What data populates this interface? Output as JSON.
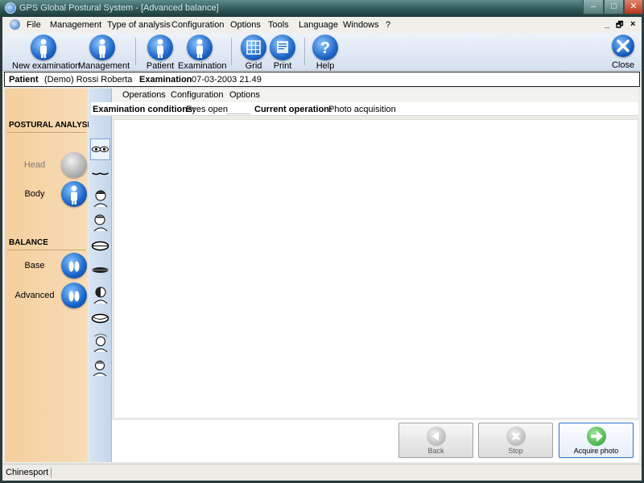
{
  "window": {
    "title": "GPS Global Postural System - [Advanced balance]",
    "minimize": "–",
    "maximize": "□",
    "close": "✕"
  },
  "menu": {
    "items": [
      "File",
      "Management",
      "Type of analysis",
      "Configuration",
      "Options",
      "Tools",
      "Language",
      "Windows",
      "?"
    ],
    "mdi_minimize": "_",
    "mdi_restore": "🗗",
    "mdi_close": "×"
  },
  "toolbar": {
    "new_examination": "New examination",
    "management": "Management",
    "patient": "Patient",
    "examination": "Examination",
    "grid": "Grid",
    "print": "Print",
    "help": "Help",
    "close": "Close"
  },
  "patient_bar": {
    "patient_label": "Patient",
    "patient_name": "(Demo) Rossi Roberta",
    "examination_label": "Examination",
    "examination_date": "07-03-2003 21.49"
  },
  "left_panel": {
    "postural_title": "POSTURAL ANALYSIS",
    "head": "Head",
    "body": "Body",
    "balance_title": "BALANCE",
    "base": "Base",
    "advanced": "Advanced"
  },
  "submenu": {
    "operations": "Operations",
    "configuration": "Configuration",
    "options": "Options"
  },
  "conditions": {
    "exam_cond_label": "Examination conditions:",
    "exam_cond_value": "Eyes open",
    "current_op_label": "Current operation:",
    "current_op_value": "Photo acquisition"
  },
  "actions": {
    "back": "Back",
    "stop": "Stop",
    "acquire": "Acquire photo"
  },
  "status": {
    "company": "Chinesport"
  },
  "colors": {
    "accent_blue": "#1e66c9",
    "panel_orange": "#f5cf9e",
    "acquire_green": "#3aa83a"
  }
}
